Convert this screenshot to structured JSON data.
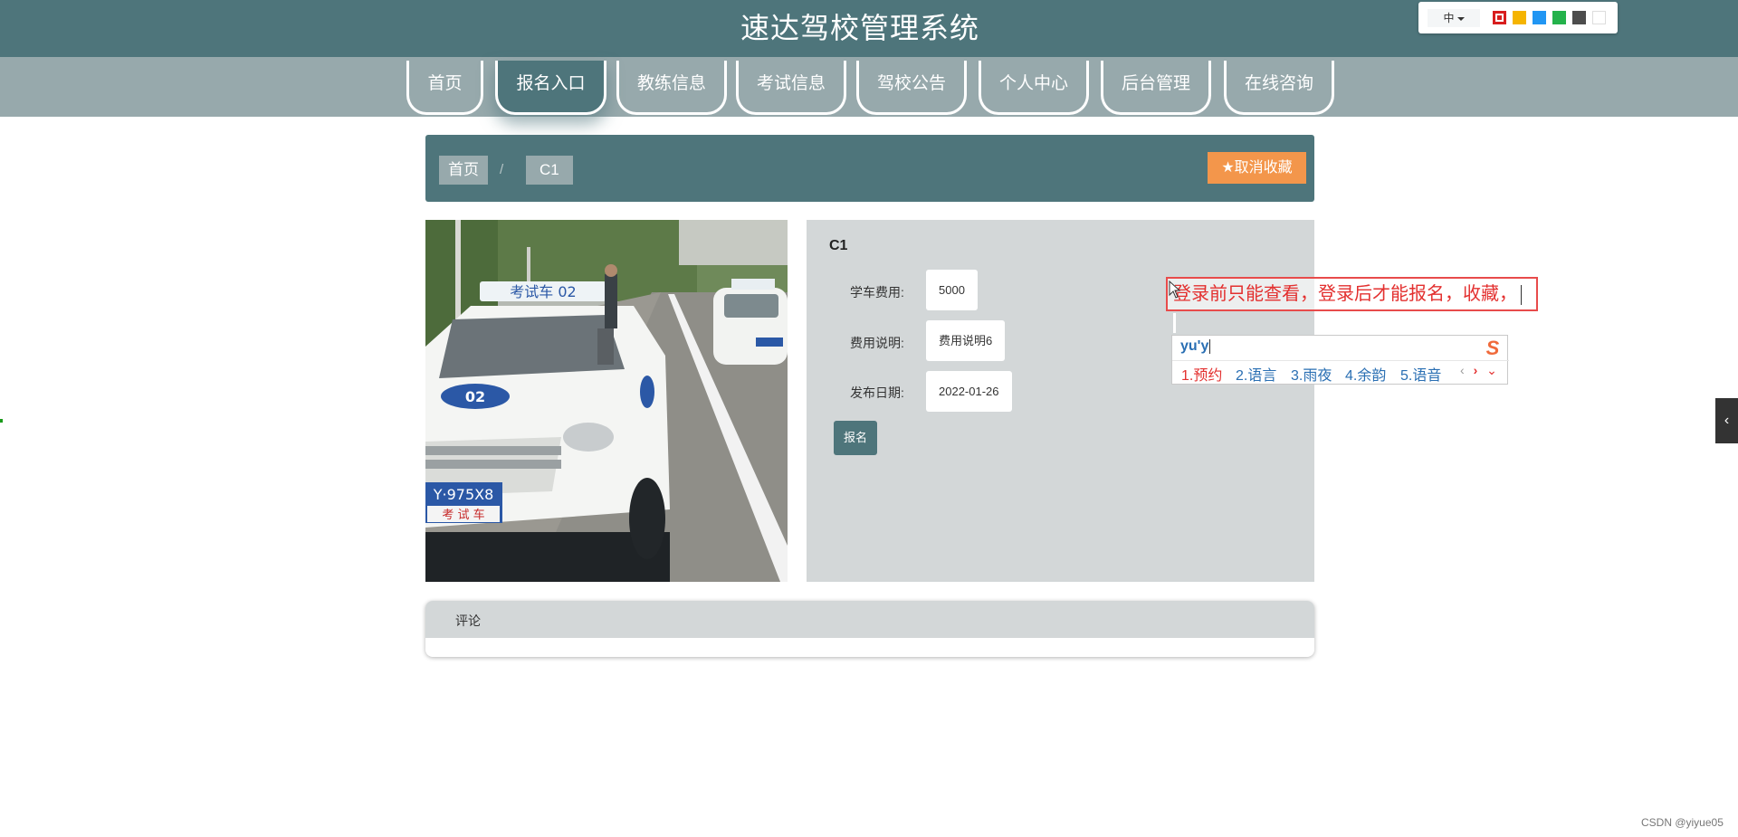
{
  "header": {
    "title": "速达驾校管理系统",
    "lang_label": "中",
    "theme_swatches": [
      "#d81e1e",
      "#f5b400",
      "#2196f3",
      "#24b24b",
      "#4d4d4d",
      "#ffffff"
    ]
  },
  "nav": {
    "active_index": 1,
    "items": [
      {
        "label": "首页"
      },
      {
        "label": "报名入口"
      },
      {
        "label": "教练信息"
      },
      {
        "label": "考试信息"
      },
      {
        "label": "驾校公告"
      },
      {
        "label": "个人中心"
      },
      {
        "label": "后台管理"
      },
      {
        "label": "在线咨询"
      }
    ]
  },
  "breadcrumb": {
    "home": "首页",
    "separator": "/",
    "current": "C1",
    "favorite_button": "取消收藏"
  },
  "detail": {
    "title": "C1",
    "fee_label": "学车费用:",
    "fee_value": "5000",
    "desc_label": "费用说明:",
    "desc_value": "费用说明6",
    "date_label": "发布日期:",
    "date_value": "2022-01-26",
    "signup_button": "报名"
  },
  "comments": {
    "title": "评论"
  },
  "ime": {
    "composed_text": "登录前只能查看，登录后才能报名，收藏，",
    "pinyin": "yu'y",
    "candidates": [
      "1.预约",
      "2.语言",
      "3.雨夜",
      "4.余韵",
      "5.语音"
    ],
    "logo": "S"
  },
  "watermark": "CSDN @yiyue05",
  "colors": {
    "primary": "#4e757b",
    "nav_bg": "#97a9ac",
    "panel_bg": "#d3d7d8",
    "favorite": "#f3964b"
  }
}
